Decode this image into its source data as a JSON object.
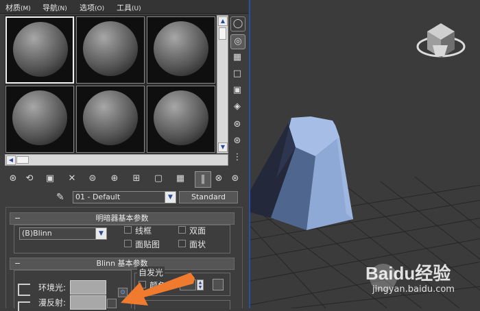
{
  "menu": {
    "items": [
      {
        "label": "材质"
      },
      {
        "label": "(M)"
      },
      {
        "label": "导航"
      },
      {
        "label": "(N)"
      },
      {
        "label": "选项"
      },
      {
        "label": "(O)"
      },
      {
        "label": "工具"
      },
      {
        "label": "(U)"
      }
    ]
  },
  "material_name": "01 - Default",
  "material_type_button": "Standard",
  "shader_basic": {
    "title": "明暗器基本参数",
    "shader_select": "(B)Blinn",
    "options": [
      "线框",
      "双面",
      "面贴图",
      "面状"
    ]
  },
  "blinn_basic": {
    "title": "Blinn 基本参数",
    "self_illum_label": "自发光",
    "self_illum_color_partial": "颜色",
    "ambient_label": "环境光:",
    "diffuse_label": "漫反射:"
  },
  "watermark": {
    "brand": "Baidu经验",
    "url": "jingyan.baidu.com"
  },
  "colors": {
    "arrow": "#f07a2e",
    "cone_light": "#8ea9d6",
    "cone_dark": "#23283a",
    "selection_blue": "#2a4ea0"
  }
}
